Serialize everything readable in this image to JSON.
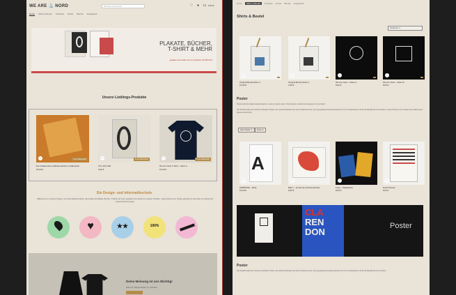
{
  "left": {
    "logo": "WE ARE ⚓ NORD",
    "search_placeholder": "Wonach suchst du?",
    "cart_total": "0,00 €",
    "nav": [
      "Home",
      "Shirts & Beutel",
      "Produkte",
      "Poster",
      "Bücher",
      "Eingekauft"
    ],
    "hero": {
      "title": "PLAKATE, BÜCHER,\nT-SHIRT & MEHR",
      "subtitle": "gestaltet und erstellt mit ♥ von Schülern der IBK Nord"
    },
    "favorites_title": "Unsere Lieblings-Produkte",
    "products": [
      {
        "name": "Die traditionelle Landfrauenküche norddeutsch",
        "price": "39,00 €",
        "cart": "In den Warenkorb"
      },
      {
        "name": "O'K, AKO-ER",
        "price": "9,00 €",
        "cart": "In den Warenkorb"
      },
      {
        "name": "We Are Nord T-Shirt – Motiv A",
        "price": "15,00 €",
        "cart": "In den Warenkorb"
      }
    ],
    "design_title": "Die Design- und Informatikschule",
    "design_text": "Willkommen in unserem Design- und Informatikschul-Shop. Hier findest du Plakate, Bücher, T-Shirts und mehr, gestaltet und erstellt von unseren Schülern. Jedes Stück ist ein Unikat, gefertigt mit viel Liebe zum Detail und Leidenschaft für Design.",
    "stamps": [
      "",
      "",
      "",
      "100%",
      ""
    ],
    "feedback_title": "Deine Meinung ist uns Wichtig!",
    "feedback_sub": "Hilf uns, Dinge besser zu machen."
  },
  "right": {
    "breadcrumb": [
      "Home",
      "Shirts & Beutel",
      "Produkte",
      "Poster",
      "Bücher",
      "Eingekauft"
    ],
    "title": "Shirts & Beutel",
    "sort_label": "Sortieren ∨",
    "bags": [
      {
        "name": "Original Beutel Motiv 1",
        "price": "10,00 €"
      },
      {
        "name": "Original Beutel Motiv 2",
        "price": "2,50 €"
      },
      {
        "name": "We Are Nord – Motiv A",
        "price": "8,00 €"
      },
      {
        "name": "We Are Nord – Motiv B",
        "price": "8,00 €"
      }
    ],
    "poster_heading": "Poster",
    "poster_text_1": "Poster sind die ideale Gestaltungsform, wenn es darum geht, Informationen schnell und prägnant zu vermitteln.",
    "poster_text_2": "Die Studierenden der Schule entwickeln Poster, die sowohl ästhetisch als auch funktional sind. Von typografischen Experimenten bis hin zu Illustrationen reicht die Bandbreite der Arbeiten. Jedes Poster ist ein Unikat und erzählt seine eigene Geschichte.",
    "filter_1": "Alle Poster ∨",
    "filter_2": "Preis ∨",
    "posters": [
      {
        "name": "AMPERSE – Riols",
        "price": "15,00 €"
      },
      {
        "name": "Blanc – Fonds des Arbeitsnachtes",
        "price": "8,00 €"
      },
      {
        "name": "Lissy – Plakatserie",
        "price": "8,00 €"
      },
      {
        "name": "David Zamen",
        "price": "8,00 €"
      }
    ],
    "banner": {
      "word_1": "CLA",
      "word_2": "REN",
      "word_3": "DON",
      "poster": "Poster"
    },
    "bottom_heading": "Poster",
    "bottom_text": "Die Studierenden der Schule entwickeln Poster, die sowohl ästhetisch als auch funktional sind. Von typografischen Experimenten bis hin zu Illustrationen reicht die Bandbreite der Arbeiten."
  }
}
